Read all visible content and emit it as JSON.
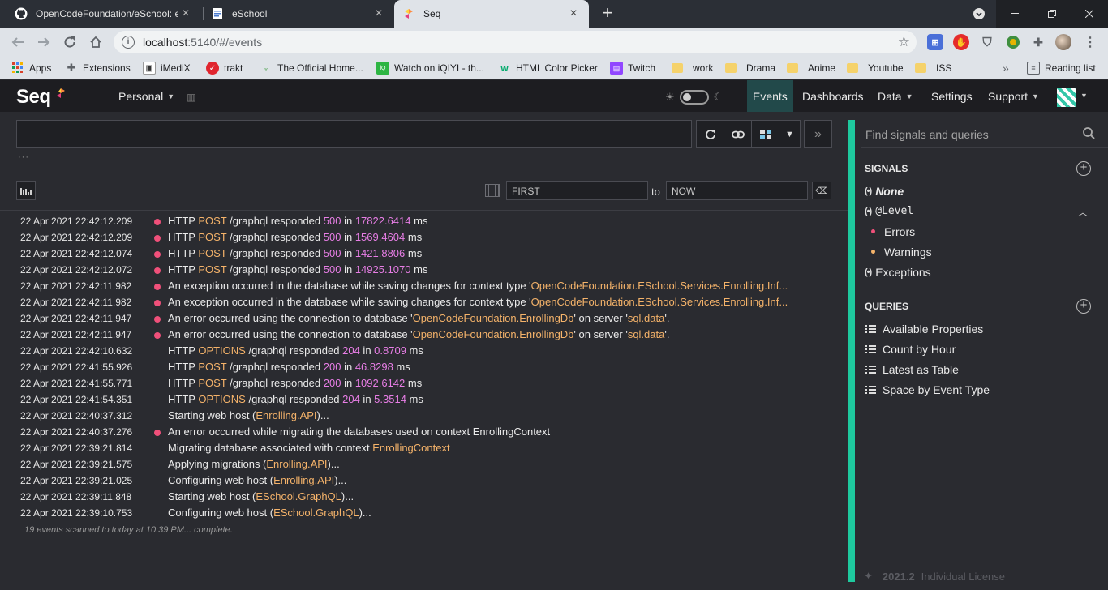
{
  "browser": {
    "tabs": [
      {
        "title": "OpenCodeFoundation/eSchool: e",
        "icon": "github-icon"
      },
      {
        "title": "eSchool",
        "icon": "document-icon"
      },
      {
        "title": "Seq",
        "icon": "seq-icon"
      }
    ],
    "new_tab": "+",
    "url_host": "localhost",
    "url_path": ":5140/#/events",
    "bookmarks": [
      {
        "label": "Apps",
        "icon": "apps-grid-icon"
      },
      {
        "label": "Extensions",
        "icon": "puzzle-icon"
      },
      {
        "label": "iMediX",
        "icon": "imedix-icon"
      },
      {
        "label": "trakt",
        "icon": "trakt-icon"
      },
      {
        "label": "The Official Home...",
        "icon": "cake-icon"
      },
      {
        "label": "Watch on iQIYI - th...",
        "icon": "iqiyi-icon"
      },
      {
        "label": "HTML Color Picker",
        "icon": "w3-icon"
      },
      {
        "label": "Twitch",
        "icon": "twitch-icon"
      },
      {
        "label": "work",
        "icon": "folder-icon"
      },
      {
        "label": "Drama",
        "icon": "folder-icon"
      },
      {
        "label": "Anime",
        "icon": "folder-icon"
      },
      {
        "label": "Youtube",
        "icon": "folder-icon"
      },
      {
        "label": "ISS",
        "icon": "folder-icon"
      }
    ],
    "more_bookmarks": "»",
    "reading_list": "Reading list"
  },
  "seq": {
    "logo": "Seq",
    "workspace": "Personal",
    "nav": [
      {
        "label": "Events",
        "active": true
      },
      {
        "label": "Dashboards"
      },
      {
        "label": "Data"
      },
      {
        "label": "Settings"
      },
      {
        "label": "Support"
      }
    ],
    "range_from": "FIRST",
    "range_to_label": "to",
    "range_to": "NOW",
    "query_ellipsis": "···",
    "events": [
      {
        "ts": "22 Apr 2021   22:42:12.209",
        "level": "error",
        "parts": [
          [
            "HTTP ",
            ""
          ],
          [
            "POST",
            "hl"
          ],
          [
            " /graphql",
            ""
          ],
          [
            " responded ",
            ""
          ],
          [
            "500",
            "num"
          ],
          [
            " in ",
            ""
          ],
          [
            "17822.6414",
            "num"
          ],
          [
            " ms",
            ""
          ]
        ]
      },
      {
        "ts": "22 Apr 2021   22:42:12.209",
        "level": "error",
        "parts": [
          [
            "HTTP ",
            ""
          ],
          [
            "POST",
            "hl"
          ],
          [
            " /graphql",
            ""
          ],
          [
            " responded ",
            ""
          ],
          [
            "500",
            "num"
          ],
          [
            " in ",
            ""
          ],
          [
            "1569.4604",
            "num"
          ],
          [
            " ms",
            ""
          ]
        ]
      },
      {
        "ts": "22 Apr 2021   22:42:12.074",
        "level": "error",
        "parts": [
          [
            "HTTP ",
            ""
          ],
          [
            "POST",
            "hl"
          ],
          [
            " /graphql",
            ""
          ],
          [
            " responded ",
            ""
          ],
          [
            "500",
            "num"
          ],
          [
            " in ",
            ""
          ],
          [
            "1421.8806",
            "num"
          ],
          [
            " ms",
            ""
          ]
        ]
      },
      {
        "ts": "22 Apr 2021   22:42:12.072",
        "level": "error",
        "parts": [
          [
            "HTTP ",
            ""
          ],
          [
            "POST",
            "hl"
          ],
          [
            " /graphql",
            ""
          ],
          [
            " responded ",
            ""
          ],
          [
            "500",
            "num"
          ],
          [
            " in ",
            ""
          ],
          [
            "14925.1070",
            "num"
          ],
          [
            " ms",
            ""
          ]
        ]
      },
      {
        "ts": "22 Apr 2021   22:42:11.982",
        "level": "error",
        "parts": [
          [
            "An exception occurred in the database while saving changes for context type '",
            ""
          ],
          [
            "OpenCodeFoundation.ESchool.Services.Enrolling.Inf...",
            "hl"
          ]
        ]
      },
      {
        "ts": "22 Apr 2021   22:42:11.982",
        "level": "error",
        "parts": [
          [
            "An exception occurred in the database while saving changes for context type '",
            ""
          ],
          [
            "OpenCodeFoundation.ESchool.Services.Enrolling.Inf...",
            "hl"
          ]
        ]
      },
      {
        "ts": "22 Apr 2021   22:42:11.947",
        "level": "error",
        "parts": [
          [
            "An error occurred using the connection to database '",
            ""
          ],
          [
            "OpenCodeFoundation.EnrollingDb",
            "hl"
          ],
          [
            "' on server '",
            ""
          ],
          [
            "sql.data",
            "hl"
          ],
          [
            "'.",
            ""
          ]
        ]
      },
      {
        "ts": "22 Apr 2021   22:42:11.947",
        "level": "error",
        "parts": [
          [
            "An error occurred using the connection to database '",
            ""
          ],
          [
            "OpenCodeFoundation.EnrollingDb",
            "hl"
          ],
          [
            "' on server '",
            ""
          ],
          [
            "sql.data",
            "hl"
          ],
          [
            "'.",
            ""
          ]
        ]
      },
      {
        "ts": "22 Apr 2021   22:42:10.632",
        "level": "info",
        "parts": [
          [
            "HTTP ",
            ""
          ],
          [
            "OPTIONS",
            "hl"
          ],
          [
            " /graphql",
            ""
          ],
          [
            " responded ",
            ""
          ],
          [
            "204",
            "num"
          ],
          [
            " in ",
            ""
          ],
          [
            "0.8709",
            "num"
          ],
          [
            " ms",
            ""
          ]
        ]
      },
      {
        "ts": "22 Apr 2021   22:41:55.926",
        "level": "info",
        "parts": [
          [
            "HTTP ",
            ""
          ],
          [
            "POST",
            "hl"
          ],
          [
            " /graphql",
            ""
          ],
          [
            " responded ",
            ""
          ],
          [
            "200",
            "num"
          ],
          [
            " in ",
            ""
          ],
          [
            "46.8298",
            "num"
          ],
          [
            " ms",
            ""
          ]
        ]
      },
      {
        "ts": "22 Apr 2021   22:41:55.771",
        "level": "info",
        "parts": [
          [
            "HTTP ",
            ""
          ],
          [
            "POST",
            "hl"
          ],
          [
            " /graphql",
            ""
          ],
          [
            " responded ",
            ""
          ],
          [
            "200",
            "num"
          ],
          [
            " in ",
            ""
          ],
          [
            "1092.6142",
            "num"
          ],
          [
            " ms",
            ""
          ]
        ]
      },
      {
        "ts": "22 Apr 2021   22:41:54.351",
        "level": "info",
        "parts": [
          [
            "HTTP ",
            ""
          ],
          [
            "OPTIONS",
            "hl"
          ],
          [
            " /graphql",
            ""
          ],
          [
            " responded ",
            ""
          ],
          [
            "204",
            "num"
          ],
          [
            " in ",
            ""
          ],
          [
            "5.3514",
            "num"
          ],
          [
            " ms",
            ""
          ]
        ]
      },
      {
        "ts": "22 Apr 2021   22:40:37.312",
        "level": "info",
        "parts": [
          [
            "Starting web host (",
            ""
          ],
          [
            "Enrolling.API",
            "hl"
          ],
          [
            ")...",
            ""
          ]
        ]
      },
      {
        "ts": "22 Apr 2021   22:40:37.276",
        "level": "error",
        "parts": [
          [
            "An error occurred while migrating the databases used on context EnrollingContext",
            ""
          ]
        ]
      },
      {
        "ts": "22 Apr 2021   22:39:21.814",
        "level": "info",
        "parts": [
          [
            "Migrating database associated with context ",
            ""
          ],
          [
            "EnrollingContext",
            "hl"
          ]
        ]
      },
      {
        "ts": "22 Apr 2021   22:39:21.575",
        "level": "info",
        "parts": [
          [
            "Applying migrations (",
            ""
          ],
          [
            "Enrolling.API",
            "hl"
          ],
          [
            ")...",
            ""
          ]
        ]
      },
      {
        "ts": "22 Apr 2021   22:39:21.025",
        "level": "info",
        "parts": [
          [
            "Configuring web host (",
            ""
          ],
          [
            "Enrolling.API",
            "hl"
          ],
          [
            ")...",
            ""
          ]
        ]
      },
      {
        "ts": "22 Apr 2021   22:39:11.848",
        "level": "info",
        "parts": [
          [
            "Starting web host (",
            ""
          ],
          [
            "ESchool.GraphQL",
            "hl"
          ],
          [
            ")...",
            ""
          ]
        ]
      },
      {
        "ts": "22 Apr 2021   22:39:10.753",
        "level": "info",
        "parts": [
          [
            "Configuring web host (",
            ""
          ],
          [
            "ESchool.GraphQL",
            "hl"
          ],
          [
            ")...",
            ""
          ]
        ]
      }
    ],
    "status": "19 events scanned to today at 10:39 PM... complete.",
    "sidebar": {
      "search_placeholder": "Find signals and queries",
      "signals_heading": "SIGNALS",
      "signals": [
        "None",
        "@Level",
        "Exceptions"
      ],
      "level_subs": [
        {
          "label": "Errors",
          "color": "#f0507a"
        },
        {
          "label": "Warnings",
          "color": "#f5b36a"
        }
      ],
      "queries_heading": "QUERIES",
      "queries": [
        "Available Properties",
        "Count by Hour",
        "Latest as Table",
        "Space by Event Type"
      ],
      "version": "2021.2",
      "license": "Individual License"
    }
  }
}
